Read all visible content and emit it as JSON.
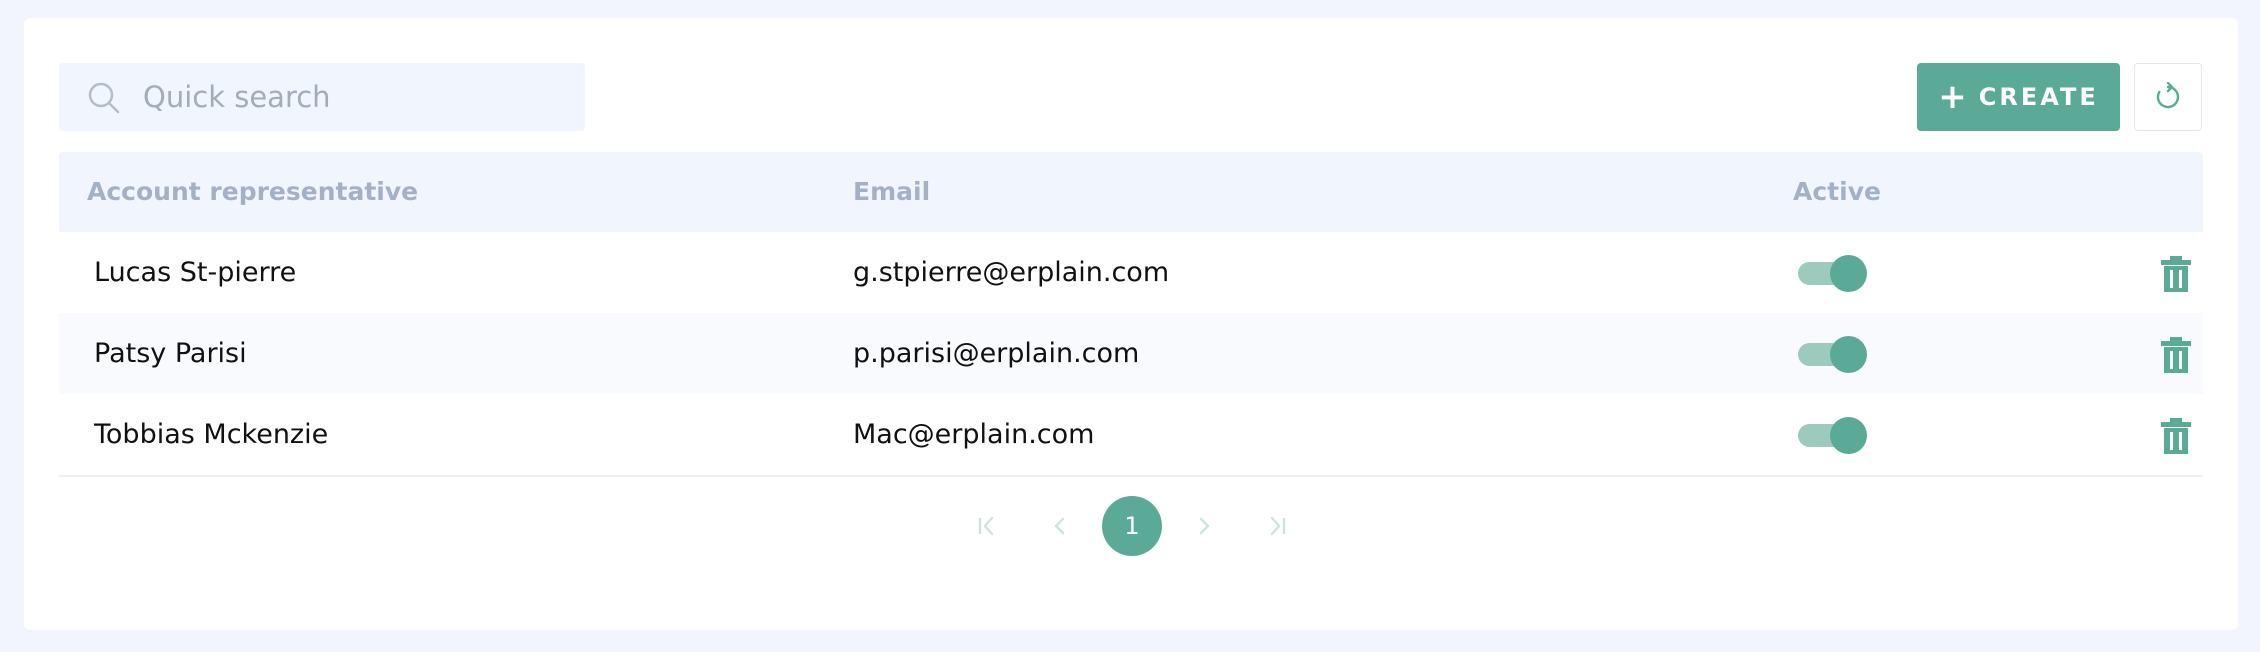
{
  "search": {
    "placeholder": "Quick search",
    "icon": "search-icon"
  },
  "toolbar": {
    "create_label": "CREATE",
    "create_icon": "plus-icon",
    "refresh_icon": "refresh-icon",
    "accent_color": "#5aaa97"
  },
  "table": {
    "columns": [
      "Account representative",
      "Email",
      "Active"
    ],
    "rows": [
      {
        "name": "Lucas St-pierre",
        "email": "g.stpierre@erplain.com",
        "active": true
      },
      {
        "name": "Patsy Parisi",
        "email": "p.parisi@erplain.com",
        "active": true
      },
      {
        "name": "Tobbias Mckenzie",
        "email": "Mac@erplain.com",
        "active": true
      }
    ]
  },
  "pagination": {
    "current_page": "1"
  }
}
